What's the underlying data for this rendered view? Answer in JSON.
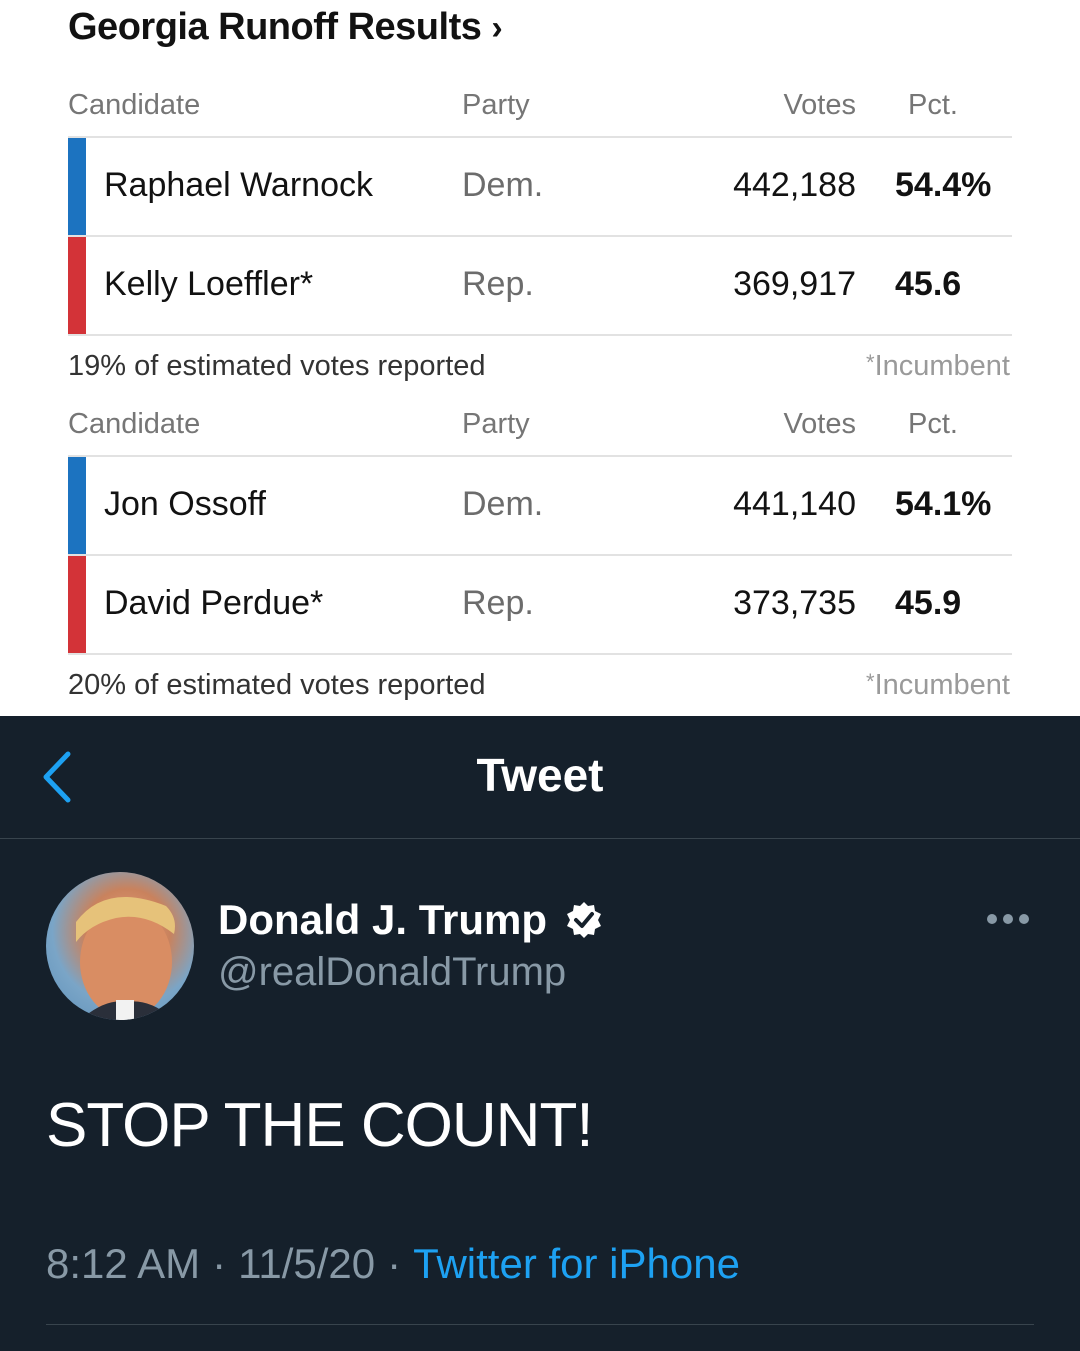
{
  "results": {
    "title": "Georgia Runoff Results",
    "title_chevron": "›",
    "races": [
      {
        "headers": {
          "candidate": "Candidate",
          "party": "Party",
          "votes": "Votes",
          "pct": "Pct."
        },
        "rows": [
          {
            "name": "Raphael Warnock",
            "party": "Dem.",
            "votes": "442,188",
            "pct": "54.4%"
          },
          {
            "name": "Kelly Loeffler*",
            "party": "Rep.",
            "votes": "369,917",
            "pct": "45.6"
          }
        ],
        "reported": "19% of estimated votes reported",
        "incumbent_note": "Incumbent"
      },
      {
        "headers": {
          "candidate": "Candidate",
          "party": "Party",
          "votes": "Votes",
          "pct": "Pct."
        },
        "rows": [
          {
            "name": "Jon Ossoff",
            "party": "Dem.",
            "votes": "441,140",
            "pct": "54.1%"
          },
          {
            "name": "David Perdue*",
            "party": "Rep.",
            "votes": "373,735",
            "pct": "45.9"
          }
        ],
        "reported": "20% of estimated votes reported",
        "incumbent_note": "Incumbent"
      }
    ],
    "colors": {
      "dem": "#1c73c0",
      "rep": "#d33338"
    }
  },
  "tweet": {
    "nav_title": "Tweet",
    "back_icon": "chevron-left-icon",
    "author": {
      "name": "Donald J. Trump",
      "handle": "@realDonaldTrump",
      "verified": true
    },
    "text": "STOP THE COUNT!",
    "time": "8:12 AM",
    "date": "11/5/20",
    "source": "Twitter for iPhone",
    "colors": {
      "background": "#15202b",
      "accent": "#1da1f2",
      "secondary": "#8899a6"
    }
  }
}
